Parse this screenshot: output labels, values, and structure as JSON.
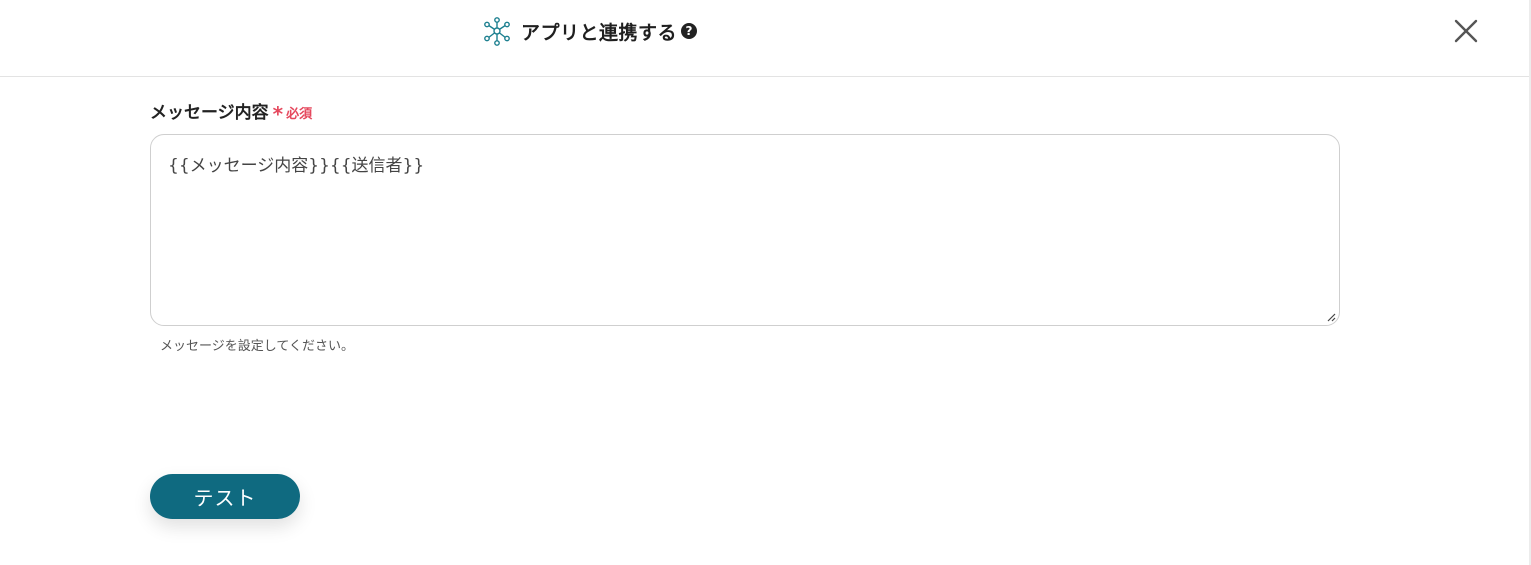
{
  "header": {
    "title": "アプリと連携する",
    "help_glyph": "?",
    "icon": "network-nodes-icon",
    "close_icon": "close-icon"
  },
  "form": {
    "field_label": "メッセージ内容",
    "required_star": "*",
    "required_text": "必須",
    "textarea_value": "{{メッセージ内容}}{{送信者}}",
    "helper_text": "メッセージを設定してください。"
  },
  "actions": {
    "test_label": "テスト"
  },
  "colors": {
    "accent": "#0f6a80",
    "required": "#e5485d",
    "border": "#cfcfcf",
    "icon_teal": "#1c7f8f"
  }
}
